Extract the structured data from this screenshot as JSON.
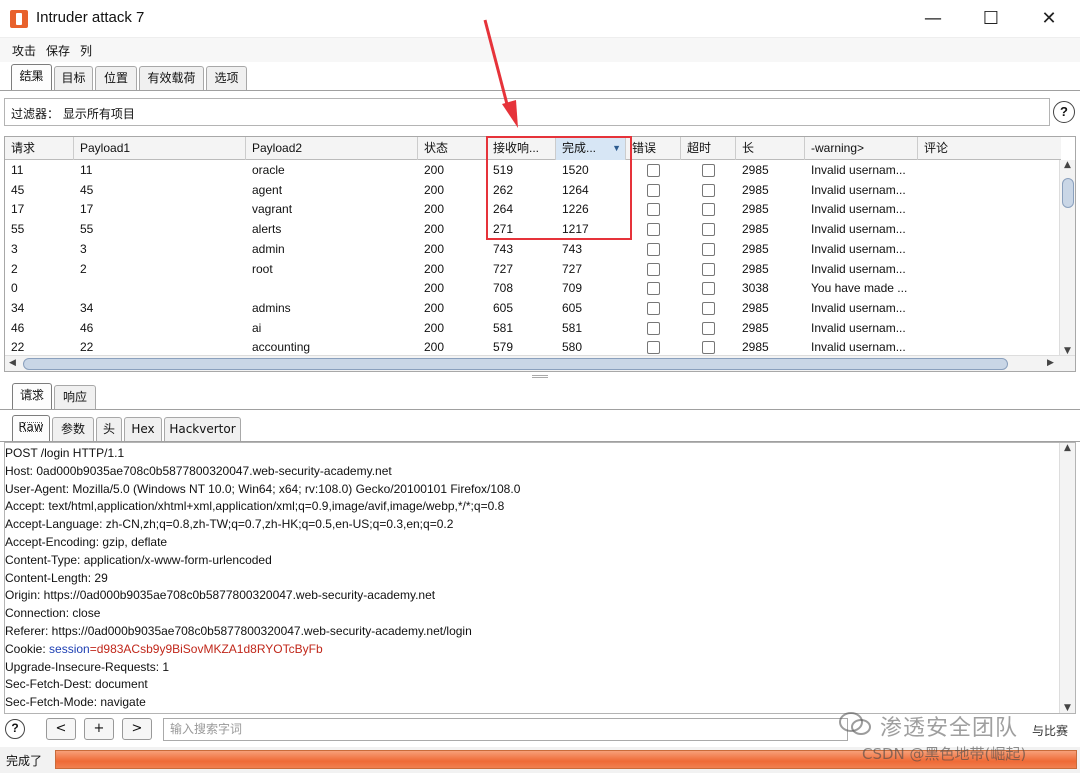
{
  "window": {
    "title": "Intruder attack 7"
  },
  "menu": [
    "攻击",
    "保存",
    "列"
  ],
  "main_tabs": [
    {
      "label": "结果",
      "active": true
    },
    {
      "label": "目标",
      "active": false
    },
    {
      "label": "位置",
      "active": false
    },
    {
      "label": "有效载荷",
      "active": false
    },
    {
      "label": "选项",
      "active": false
    }
  ],
  "filter": {
    "text": "过滤器： 显示所有项目"
  },
  "table": {
    "columns": [
      "请求",
      "Payload1",
      "Payload2",
      "状态",
      "接收响...",
      "完成...",
      "错误",
      "超时",
      "长",
      "-warning>",
      "评论"
    ],
    "sorted_column": "完成...",
    "rows": [
      {
        "req": "11",
        "p1": "11",
        "p2": "oracle",
        "status": "200",
        "recv": "519",
        "done": "1520",
        "len": "2985",
        "warn": "Invalid usernam..."
      },
      {
        "req": "45",
        "p1": "45",
        "p2": "agent",
        "status": "200",
        "recv": "262",
        "done": "1264",
        "len": "2985",
        "warn": "Invalid usernam..."
      },
      {
        "req": "17",
        "p1": "17",
        "p2": "vagrant",
        "status": "200",
        "recv": "264",
        "done": "1226",
        "len": "2985",
        "warn": "Invalid usernam..."
      },
      {
        "req": "55",
        "p1": "55",
        "p2": "alerts",
        "status": "200",
        "recv": "271",
        "done": "1217",
        "len": "2985",
        "warn": "Invalid usernam..."
      },
      {
        "req": "3",
        "p1": "3",
        "p2": "admin",
        "status": "200",
        "recv": "743",
        "done": "743",
        "len": "2985",
        "warn": "Invalid usernam..."
      },
      {
        "req": "2",
        "p1": "2",
        "p2": "root",
        "status": "200",
        "recv": "727",
        "done": "727",
        "len": "2985",
        "warn": "Invalid usernam..."
      },
      {
        "req": "0",
        "p1": "",
        "p2": "",
        "status": "200",
        "recv": "708",
        "done": "709",
        "len": "3038",
        "warn": "You have made ..."
      },
      {
        "req": "34",
        "p1": "34",
        "p2": "admins",
        "status": "200",
        "recv": "605",
        "done": "605",
        "len": "2985",
        "warn": "Invalid usernam..."
      },
      {
        "req": "46",
        "p1": "46",
        "p2": "ai",
        "status": "200",
        "recv": "581",
        "done": "581",
        "len": "2985",
        "warn": "Invalid usernam..."
      },
      {
        "req": "22",
        "p1": "22",
        "p2": "accounting",
        "status": "200",
        "recv": "579",
        "done": "580",
        "len": "2985",
        "warn": "Invalid usernam..."
      }
    ]
  },
  "req_resp_tabs": [
    {
      "label": "请求",
      "active": true
    },
    {
      "label": "响应",
      "active": false
    }
  ],
  "view_tabs": [
    {
      "label": "Raw",
      "active": true
    },
    {
      "label": "参数",
      "active": false
    },
    {
      "label": "头",
      "active": false
    },
    {
      "label": "Hex",
      "active": false
    },
    {
      "label": "Hackvertor",
      "active": false
    }
  ],
  "request_lines": [
    "POST /login HTTP/1.1",
    "Host: 0ad000b9035ae708c0b5877800320047.web-security-academy.net",
    "User-Agent: Mozilla/5.0 (Windows NT 10.0; Win64; x64; rv:108.0) Gecko/20100101 Firefox/108.0",
    "Accept: text/html,application/xhtml+xml,application/xml;q=0.9,image/avif,image/webp,*/*;q=0.8",
    "Accept-Language: zh-CN,zh;q=0.8,zh-TW;q=0.7,zh-HK;q=0.5,en-US;q=0.3,en;q=0.2",
    "Accept-Encoding: gzip, deflate",
    "Content-Type: application/x-www-form-urlencoded",
    "Content-Length: 29",
    "Origin: https://0ad000b9035ae708c0b5877800320047.web-security-academy.net",
    "Connection: close",
    "Referer: https://0ad000b9035ae708c0b5877800320047.web-security-academy.net/login",
    "Cookie: ",
    "Upgrade-Insecure-Requests: 1",
    "Sec-Fetch-Dest: document",
    "Sec-Fetch-Mode: navigate"
  ],
  "cookie": {
    "name": "session",
    "value": "d983ACsb9y9BiSovMKZA1d8RYOTcByFb"
  },
  "search": {
    "placeholder": "输入搜索字词",
    "prev": "<",
    "add": "+",
    "next": ">"
  },
  "status": {
    "text": "完成了",
    "progress": 1.0
  },
  "watermark": {
    "team": "渗透安全团队",
    "csdn": "CSDN @黑色地带(崛起)",
    "tail": "与比赛"
  },
  "colors": {
    "highlight": "#e6333a",
    "progress": "#ef6a36",
    "cookie_name": "#1d3fb3",
    "cookie_value": "#c0271a"
  }
}
